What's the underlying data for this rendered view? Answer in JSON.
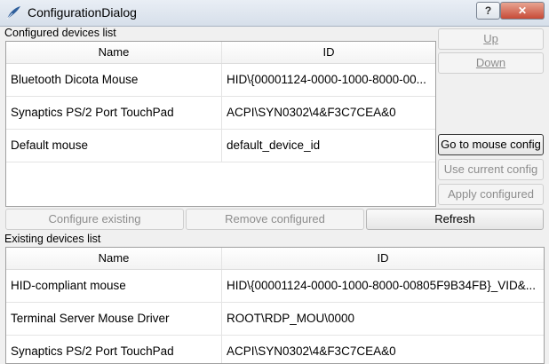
{
  "window": {
    "title": "ConfigurationDialog",
    "help_label": "?",
    "close_label": "✕"
  },
  "configured": {
    "group_label": "Configured devices list",
    "columns": [
      "Name",
      "ID"
    ],
    "rows": [
      {
        "name": "Bluetooth Dicota Mouse",
        "id": "HID\\{00001124-0000-1000-8000-00..."
      },
      {
        "name": "Synaptics PS/2 Port TouchPad",
        "id": "ACPI\\SYN0302\\4&F3C7CEA&0"
      },
      {
        "name": "Default mouse",
        "id": "default_device_id"
      }
    ]
  },
  "side_buttons": {
    "up": "Up",
    "down": "Down",
    "goto": "Go to mouse config",
    "use_current": "Use current config",
    "apply": "Apply configured"
  },
  "action_buttons": {
    "configure": "Configure existing",
    "remove": "Remove configured",
    "refresh": "Refresh"
  },
  "existing": {
    "group_label": "Existing devices list",
    "columns": [
      "Name",
      "ID"
    ],
    "rows": [
      {
        "name": "HID-compliant mouse",
        "id": "HID\\{00001124-0000-1000-8000-00805F9B34FB}_VID&..."
      },
      {
        "name": "Terminal Server Mouse Driver",
        "id": "ROOT\\RDP_MOU\\0000"
      },
      {
        "name": "Synaptics PS/2 Port TouchPad",
        "id": "ACPI\\SYN0302\\4&F3C7CEA&0"
      }
    ]
  }
}
